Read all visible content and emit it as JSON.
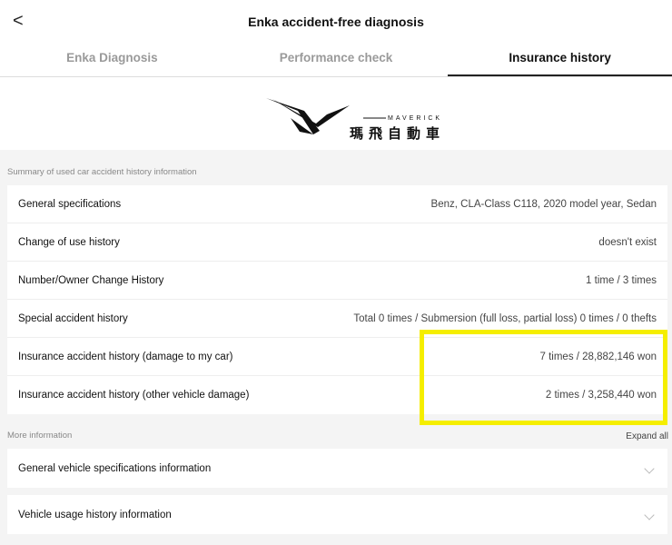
{
  "header": {
    "back": "<",
    "title": "Enka accident-free diagnosis"
  },
  "tabs": [
    {
      "label": "Enka Diagnosis"
    },
    {
      "label": "Performance check"
    },
    {
      "label": "Insurance history"
    }
  ],
  "logo": {
    "en": "MAVERICK",
    "zh": "瑪飛自動車"
  },
  "summary": {
    "label": "Summary of used car accident history information",
    "rows": [
      {
        "label": "General specifications",
        "value": "Benz, CLA-Class C118, 2020 model year, Sedan"
      },
      {
        "label": "Change of use history",
        "value": "doesn't exist"
      },
      {
        "label": "Number/Owner Change History",
        "value": "1 time / 3 times"
      },
      {
        "label": "Special accident history",
        "value": "Total 0 times / Submersion (full loss, partial loss) 0 times / 0 thefts"
      },
      {
        "label": "Insurance accident history (damage to my car)",
        "value": "7 times / 28,882,146 won"
      },
      {
        "label": "Insurance accident history (other vehicle damage)",
        "value": "2 times / 3,258,440 won"
      }
    ]
  },
  "more": {
    "label": "More information",
    "expand": "Expand all",
    "items": [
      {
        "label": "General vehicle specifications information"
      },
      {
        "label": "Vehicle usage history information"
      }
    ]
  },
  "colors": {
    "highlight": "#f5ee00"
  }
}
